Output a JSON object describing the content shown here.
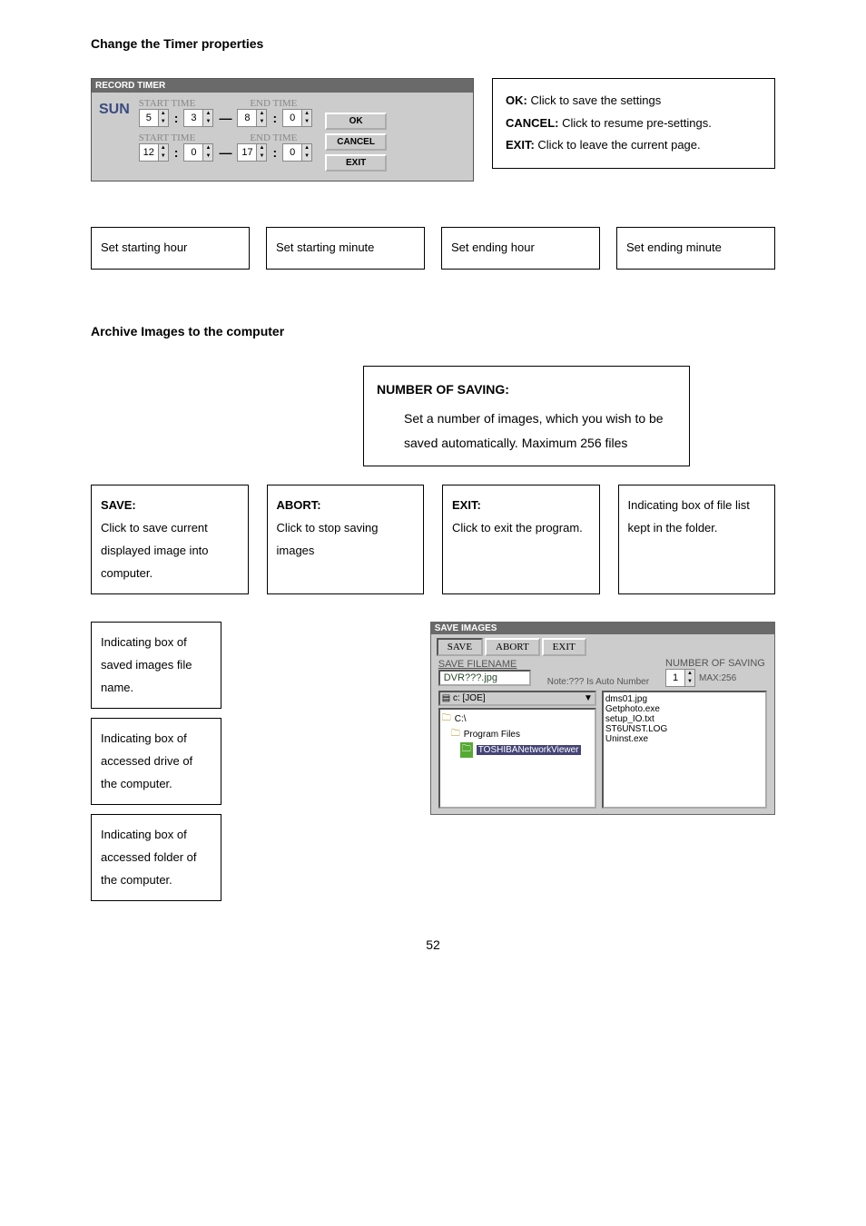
{
  "page_number": "52",
  "section1": {
    "title": "Change the Timer properties",
    "panel": {
      "window_title": "RECORD TIMER",
      "day": "SUN",
      "start_label": "START TIME",
      "end_label": "END TIME",
      "row1": {
        "sh": "5",
        "sm": "3",
        "eh": "8",
        "em": "0"
      },
      "row2": {
        "sh": "12",
        "sm": "0",
        "eh": "17",
        "em": "0"
      },
      "buttons": {
        "ok": "OK",
        "cancel": "CANCEL",
        "exit": "EXIT"
      }
    },
    "side_box": {
      "ok_b": "OK:",
      "ok_t": " Click to save the settings",
      "cancel_b": "CANCEL:",
      "cancel_t": " Click to resume pre-settings.",
      "exit_b": "EXIT:",
      "exit_t": " Click to leave the current page."
    },
    "callouts": {
      "a": "Set starting hour",
      "b": "Set starting minute",
      "c": "Set ending hour",
      "d": "Set ending minute"
    }
  },
  "section2": {
    "title": "Archive Images to the computer",
    "num_save": {
      "heading": "NUMBER OF SAVING:",
      "text": "Set a number of images, which you wish to be saved automatically. Maximum 256 files"
    },
    "boxes": {
      "save_h": "SAVE:",
      "save_t": "Click to save current displayed image into computer.",
      "abort_h": "ABORT:",
      "abort_t": "Click to stop saving images",
      "exit_h": "EXIT:",
      "exit_t": "Click to exit the program.",
      "ind_file_list": "Indicating box of file list kept in the folder.",
      "ind_filename": "Indicating box of saved images file name.",
      "ind_drive": "Indicating box of accessed drive of the computer.",
      "ind_folder": "Indicating box of accessed folder of the computer."
    },
    "panel": {
      "window_title": "SAVE IMAGES",
      "tabs": {
        "save": "SAVE",
        "abort": "ABORT",
        "exit": "EXIT"
      },
      "filename_label": "SAVE FILENAME",
      "filename_value": "DVR???.jpg",
      "note": "Note:??? Is Auto Number",
      "numsave_label": "NUMBER OF SAVING",
      "numsave_val": "1",
      "numsave_max": "MAX:256",
      "drive": "c: [JOE]",
      "folder_root": "C:\\",
      "folder_prog": "Program Files",
      "folder_sel": "TOSHIBANetworkViewer",
      "files": [
        "dms01.jpg",
        "Getphoto.exe",
        "setup_IO.txt",
        "ST6UNST.LOG",
        "Uninst.exe"
      ]
    }
  }
}
